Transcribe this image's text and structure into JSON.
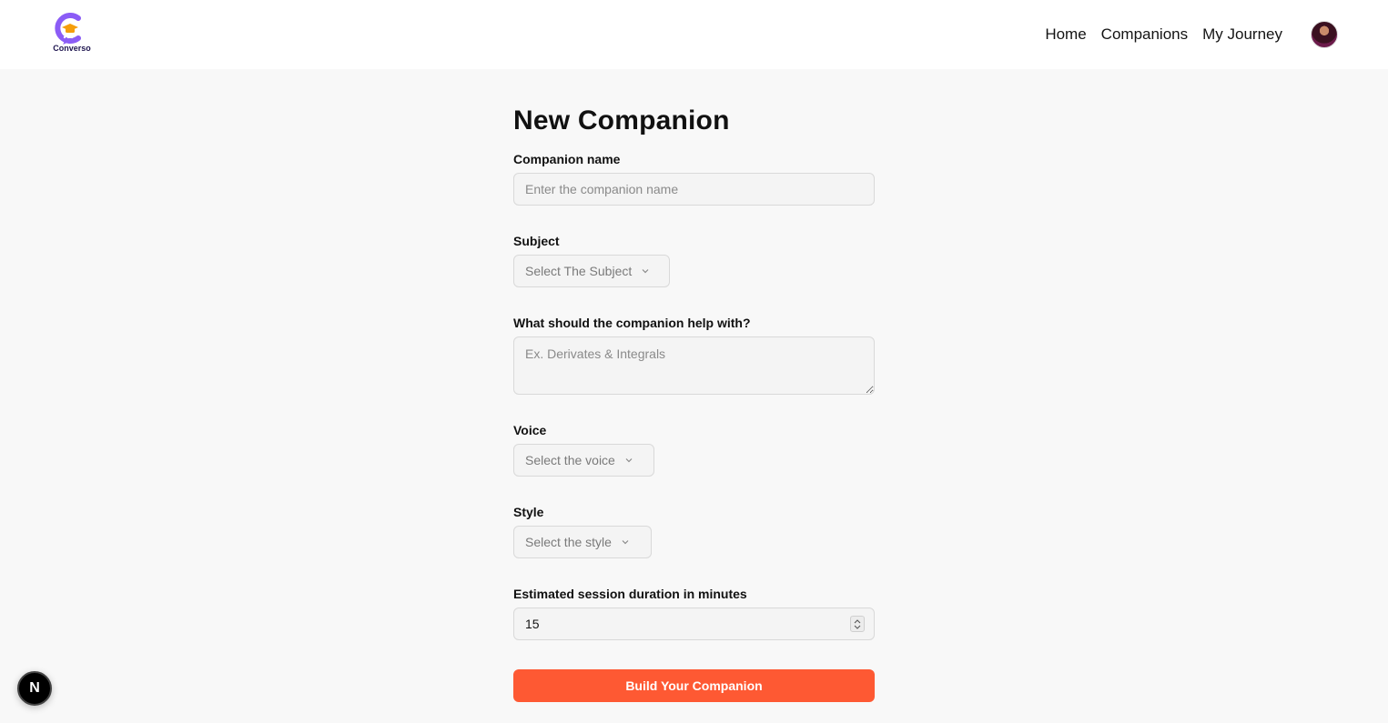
{
  "brand": {
    "name": "Converso",
    "accent": "#fe5933",
    "logo_color": "#9b5de5"
  },
  "nav": {
    "links": [
      "Home",
      "Companions",
      "My Journey"
    ]
  },
  "form": {
    "title": "New Companion",
    "name": {
      "label": "Companion name",
      "placeholder": "Enter the companion name"
    },
    "subject": {
      "label": "Subject",
      "placeholder": "Select The Subject"
    },
    "topic": {
      "label": "What should the companion help with?",
      "placeholder": "Ex. Derivates & Integrals"
    },
    "voice": {
      "label": "Voice",
      "placeholder": "Select the voice"
    },
    "style": {
      "label": "Style",
      "placeholder": "Select the style"
    },
    "duration": {
      "label": "Estimated session duration in minutes",
      "value": "15"
    },
    "submit_label": "Build Your Companion"
  },
  "dev_badge": {
    "letter": "N"
  }
}
